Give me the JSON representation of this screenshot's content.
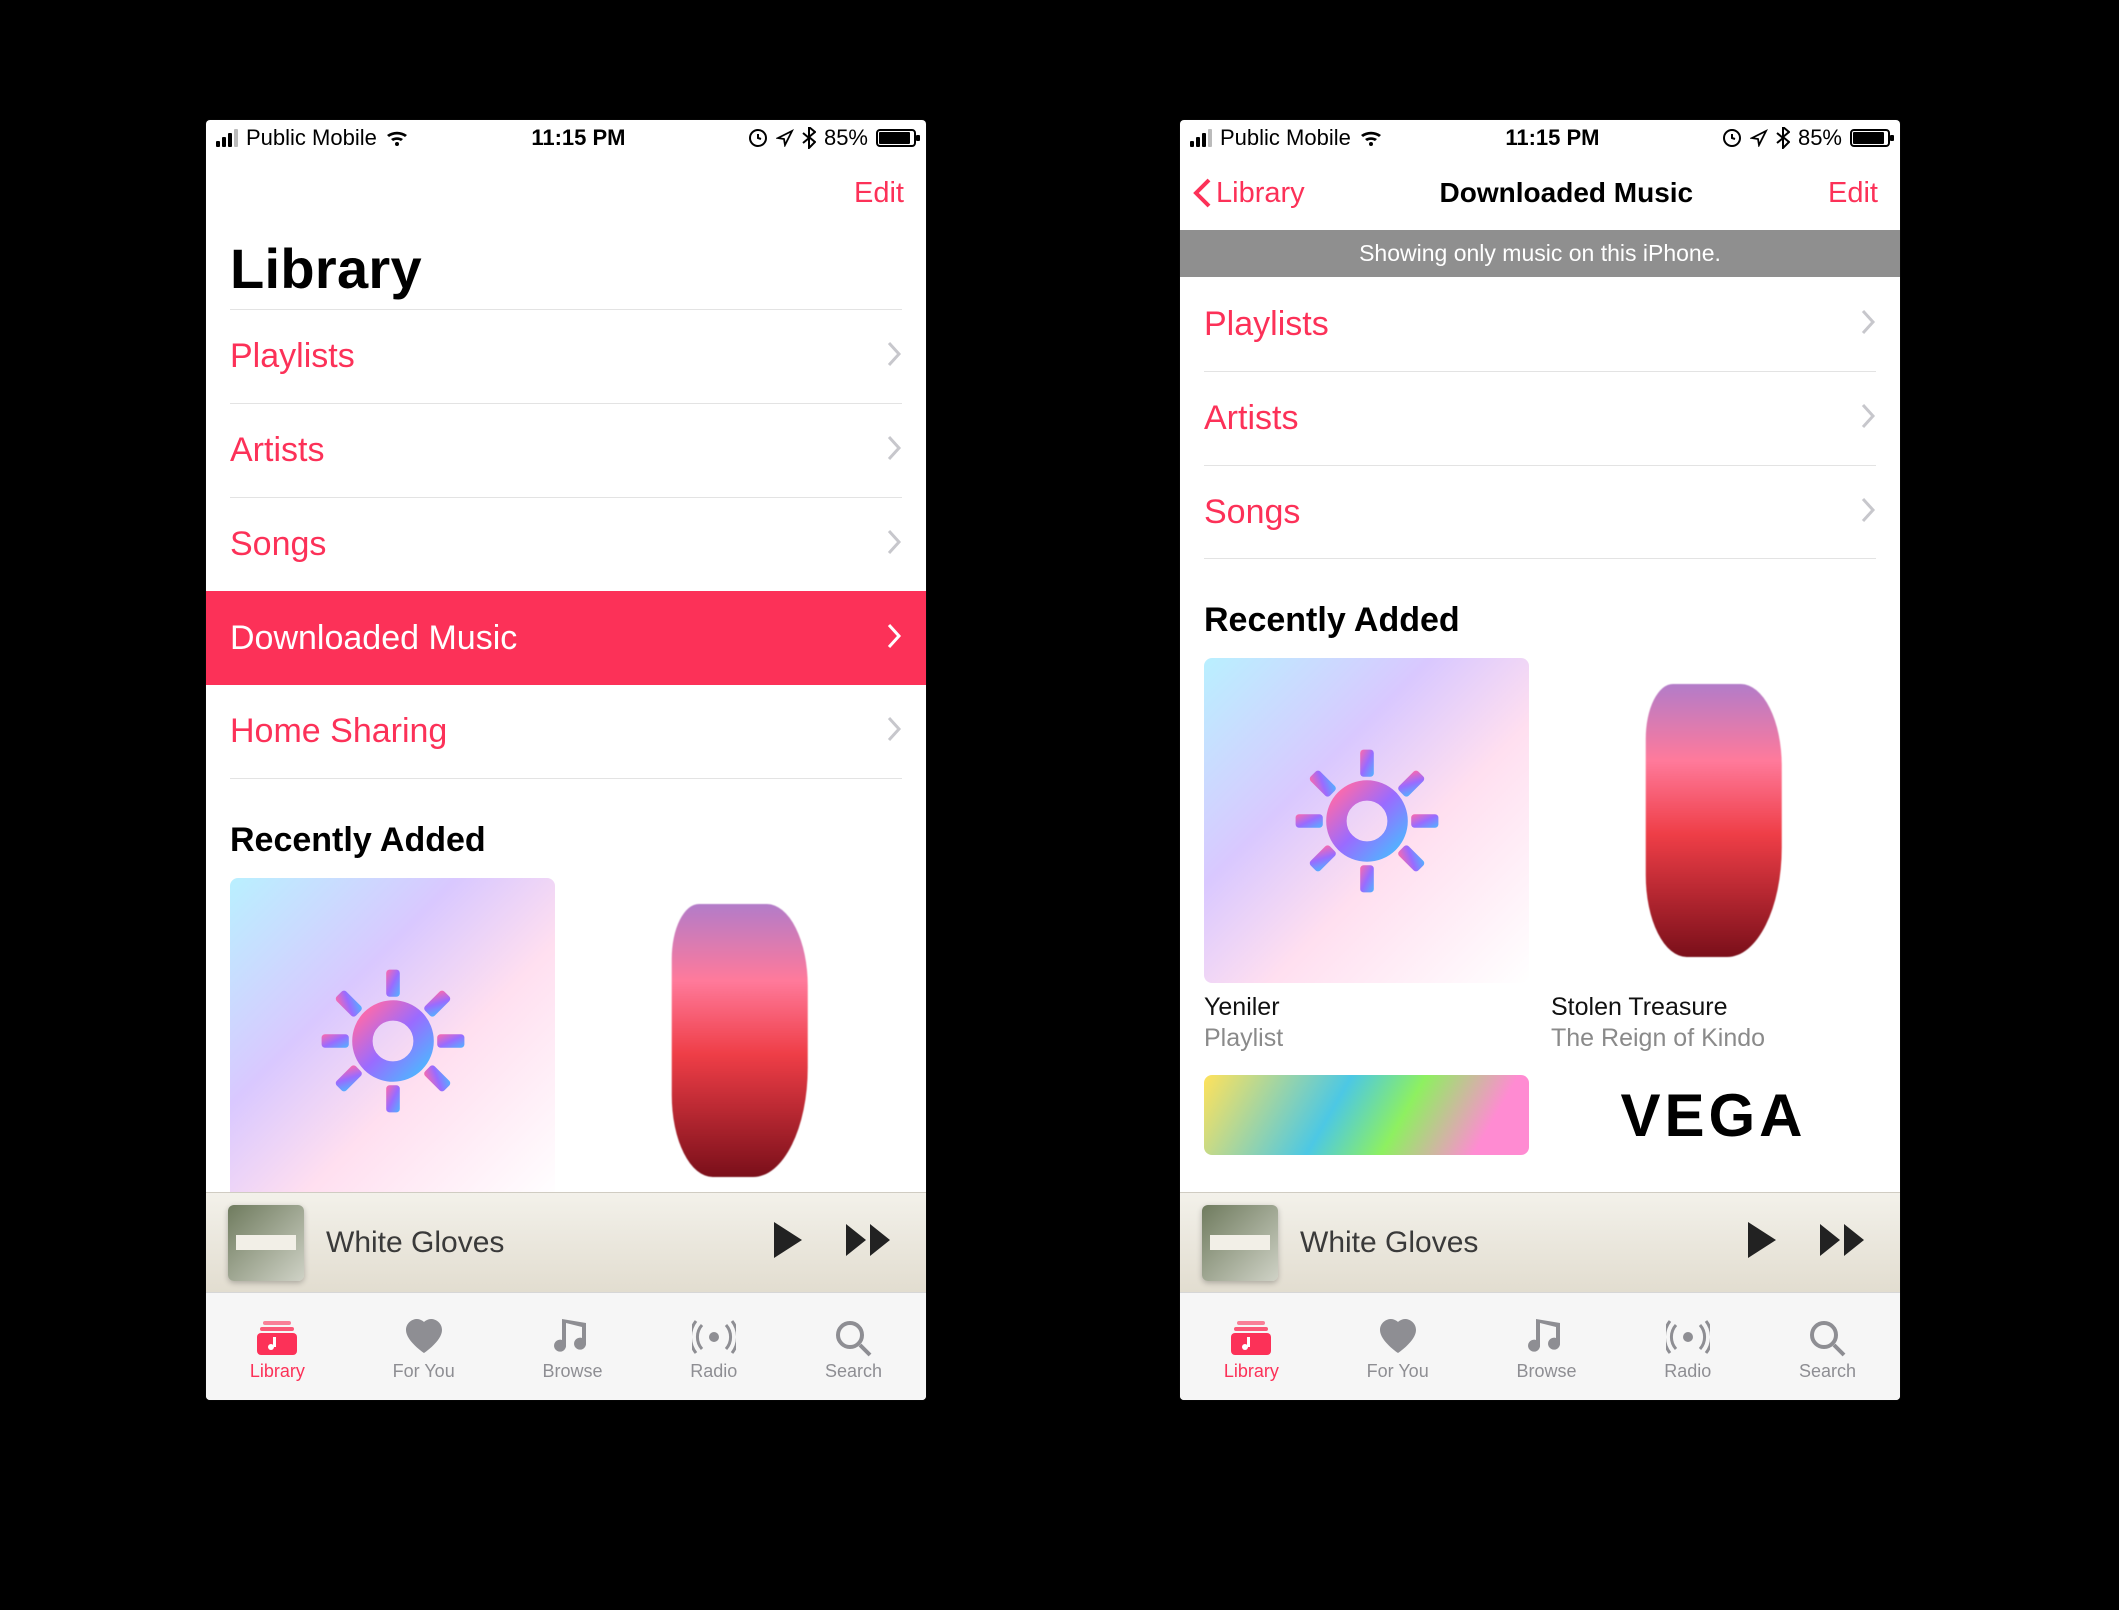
{
  "colors": {
    "accent": "#fc3158"
  },
  "status_bar": {
    "carrier": "Public Mobile",
    "time": "11:15 PM",
    "battery_pct": "85%"
  },
  "tabs": {
    "items": [
      {
        "id": "library",
        "label": "Library"
      },
      {
        "id": "for-you",
        "label": "For You"
      },
      {
        "id": "browse",
        "label": "Browse"
      },
      {
        "id": "radio",
        "label": "Radio"
      },
      {
        "id": "search",
        "label": "Search"
      }
    ],
    "active": "library"
  },
  "miniplayer": {
    "track": "White Gloves"
  },
  "screens": {
    "library": {
      "nav_edit": "Edit",
      "large_title": "Library",
      "categories": [
        {
          "label": "Playlists",
          "selected": false
        },
        {
          "label": "Artists",
          "selected": false
        },
        {
          "label": "Songs",
          "selected": false
        },
        {
          "label": "Downloaded Music",
          "selected": true
        },
        {
          "label": "Home Sharing",
          "selected": false
        }
      ],
      "recent_title": "Recently Added"
    },
    "downloaded": {
      "back_label": "Library",
      "nav_title": "Downloaded Music",
      "nav_edit": "Edit",
      "banner": "Showing only music on this iPhone.",
      "categories": [
        {
          "label": "Playlists"
        },
        {
          "label": "Artists"
        },
        {
          "label": "Songs"
        }
      ],
      "recent_title": "Recently Added",
      "recent_items": [
        {
          "title": "Yeniler",
          "subtitle": "Playlist",
          "art": "gear"
        },
        {
          "title": "Stolen Treasure",
          "subtitle": "The Reign of Kindo",
          "art": "stolen"
        },
        {
          "title": "",
          "subtitle": "",
          "art": "abstract"
        },
        {
          "title": "",
          "subtitle": "",
          "art": "vega",
          "art_text": "VEGA"
        }
      ]
    }
  }
}
